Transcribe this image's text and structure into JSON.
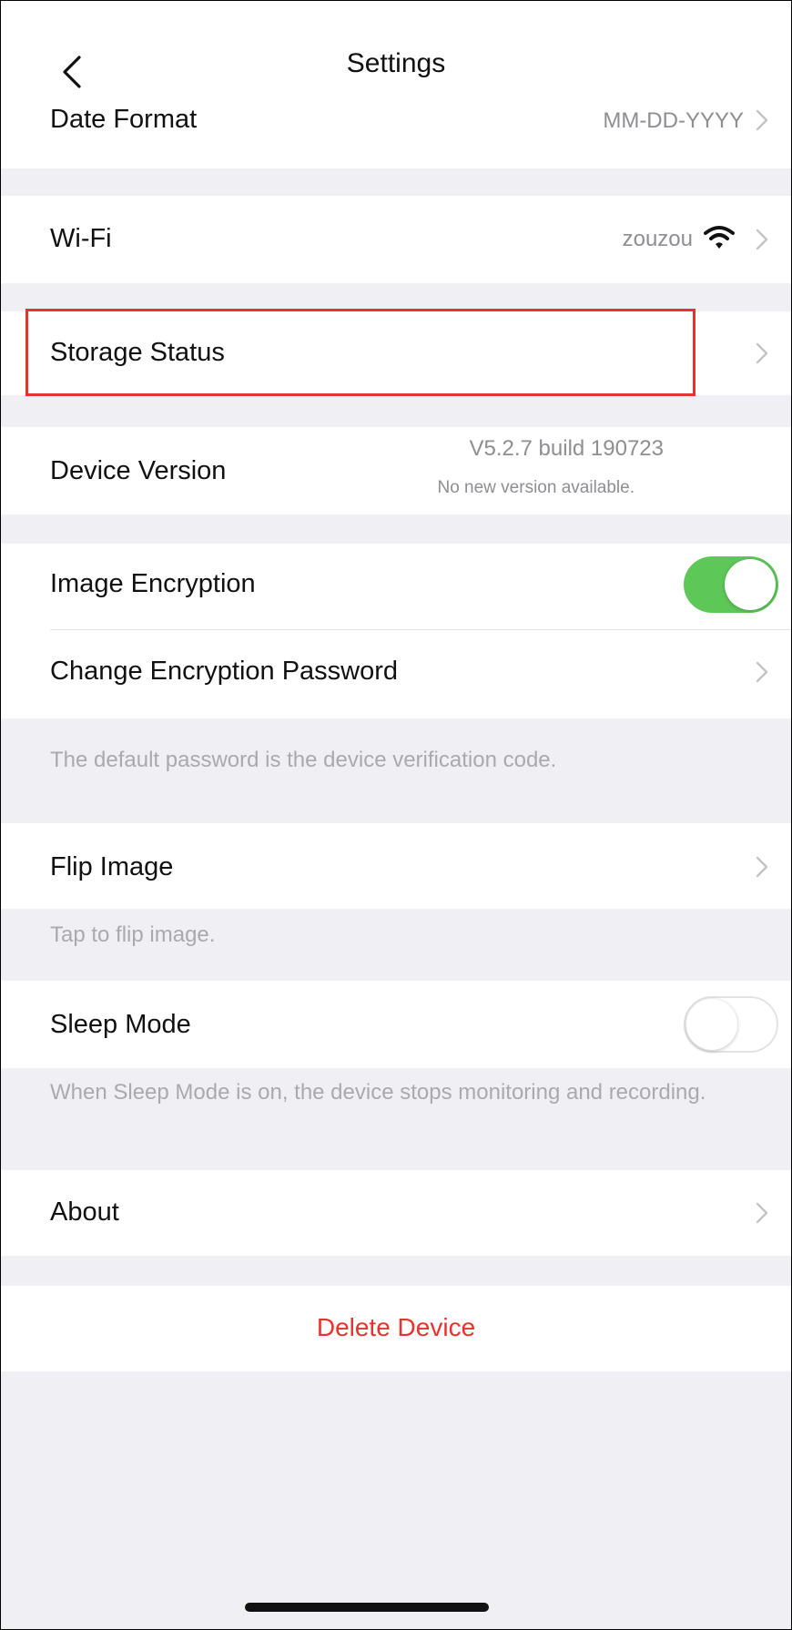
{
  "nav": {
    "title": "Settings",
    "back_icon": "chevron-left-icon"
  },
  "date_format": {
    "label": "Date Format",
    "value": "MM-DD-YYYY"
  },
  "wifi": {
    "label": "Wi-Fi",
    "network": "zouzou",
    "icon": "wifi-icon"
  },
  "storage_status": {
    "label": "Storage Status",
    "highlight_color": "#e8322d"
  },
  "device_version": {
    "label": "Device Version",
    "version": "V5.2.7 build 190723",
    "note": "No new version available."
  },
  "image_encryption": {
    "label": "Image Encryption",
    "enabled": true
  },
  "change_password": {
    "label": "Change Encryption Password",
    "footer": "The default password is the device verification code."
  },
  "flip_image": {
    "label": "Flip Image",
    "footer": "Tap to flip image."
  },
  "sleep_mode": {
    "label": "Sleep Mode",
    "enabled": false,
    "footer": "When Sleep Mode is on, the device stops monitoring and recording."
  },
  "about": {
    "label": "About"
  },
  "delete_device": {
    "label": "Delete Device"
  },
  "colors": {
    "accent_red": "#e8322d",
    "toggle_on": "#5dc858",
    "background": "#efeff4"
  }
}
